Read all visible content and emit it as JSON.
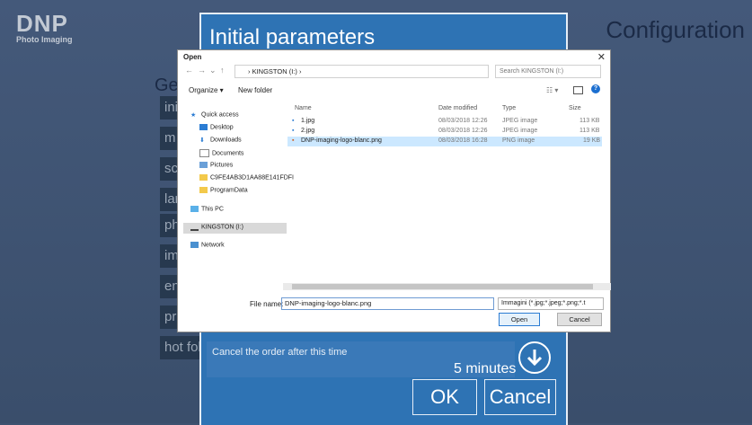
{
  "app": {
    "logo_main": "DNP",
    "logo_sub": "Photo Imaging",
    "config_title": "Configuration",
    "panel_title": "Initial parameters",
    "side_label": "Ge",
    "side_buttons": [
      "ini",
      "m",
      "sc",
      "lar",
      "ph",
      "im",
      "en",
      "pr",
      "hot fol"
    ],
    "cancel_order_text": "Cancel the order after this time",
    "minutes": "5 minutes",
    "ok_label": "OK",
    "cancel_label": "Cancel"
  },
  "dialog": {
    "title": "Open",
    "close": "✕",
    "address": "› KINGSTON (I:) ›",
    "search_placeholder": "Search KINGSTON (I:)",
    "organize": "Organize ▾",
    "new_folder": "New folder",
    "nav_items": [
      {
        "label": "Quick access",
        "icon": "star-icon"
      },
      {
        "label": "Desktop",
        "icon": "desktop-icon"
      },
      {
        "label": "Downloads",
        "icon": "download-icon"
      },
      {
        "label": "Documents",
        "icon": "documents-icon"
      },
      {
        "label": "Pictures",
        "icon": "pictures-icon"
      },
      {
        "label": "C9FE4AB3D1AA88E141FDFI",
        "icon": "folder-icon"
      },
      {
        "label": "ProgramData",
        "icon": "folder-icon"
      },
      {
        "label": "This PC",
        "icon": "pc-icon"
      },
      {
        "label": "KINGSTON (I:)",
        "icon": "drive-icon"
      },
      {
        "label": "Network",
        "icon": "network-icon"
      }
    ],
    "columns": {
      "name": "Name",
      "date": "Date modified",
      "type": "Type",
      "size": "Size"
    },
    "files": [
      {
        "name": "1.jpg",
        "date": "08/03/2018 12:26",
        "type": "JPEG image",
        "size": "113 KB"
      },
      {
        "name": "2.jpg",
        "date": "08/03/2018 12:26",
        "type": "JPEG image",
        "size": "113 KB"
      },
      {
        "name": "DNP-imaging-logo-blanc.png",
        "date": "08/03/2018 16:28",
        "type": "PNG image",
        "size": "19 KB"
      }
    ],
    "file_name_label": "File name:",
    "file_name_value": "DNP-imaging-logo-blanc.png",
    "filter": "Immagini (*.jpg;*.jpeg;*.png;*.t",
    "open_button": "Open",
    "cancel_button": "Cancel"
  }
}
